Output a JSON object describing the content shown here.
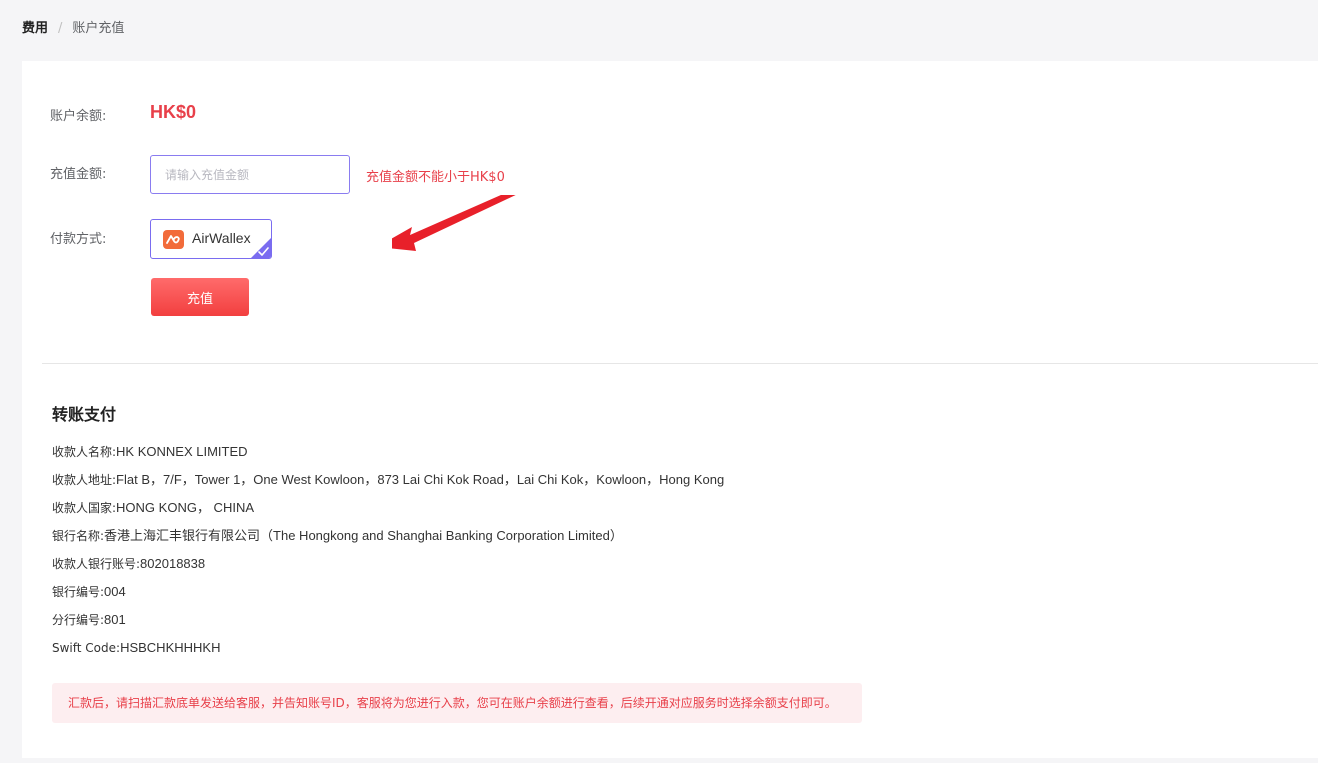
{
  "breadcrumb": {
    "root": "费用",
    "separator": "/",
    "current": "账户充值"
  },
  "balance": {
    "label": "账户余额:",
    "value": "HK$0"
  },
  "amount": {
    "label": "充值金额:",
    "placeholder": "请输入充值金额",
    "value": "",
    "hint": "充值金额不能小于HK$0"
  },
  "payment": {
    "label": "付款方式:",
    "option": "AirWallex",
    "logo_icon": "airwallex-logo",
    "selected": true
  },
  "recharge_button": "充值",
  "transfer": {
    "title": "转账支付",
    "lines": [
      {
        "label": "收款人名称:",
        "value": "HK KONNEX LIMITED"
      },
      {
        "label": "收款人地址:",
        "value": "Flat B，7/F，Tower 1，One West Kowloon，873 Lai Chi Kok Road，Lai Chi Kok，Kowloon，Hong Kong"
      },
      {
        "label": "收款人国家:",
        "value": "HONG KONG， CHINA"
      },
      {
        "label": "银行名称:",
        "value": "香港上海汇丰银行有限公司（The Hongkong and Shanghai Banking Corporation Limited）"
      },
      {
        "label": "收款人银行账号:",
        "value": "802018838"
      },
      {
        "label": "银行编号:",
        "value": "004"
      },
      {
        "label": "分行编号:",
        "value": "801"
      },
      {
        "label": "Swift Code:",
        "value": "HSBCHKHHHKH"
      }
    ],
    "notice": "汇款后，请扫描汇款底单发送给客服，并告知账号ID，客服将为您进行入款，您可在账户余额进行查看，后续开通对应服务时选择余额支付即可。"
  },
  "colors": {
    "accent_red": "#e8404a",
    "accent_purple": "#7a6cf0",
    "brand_orange": "#f26b3a"
  }
}
